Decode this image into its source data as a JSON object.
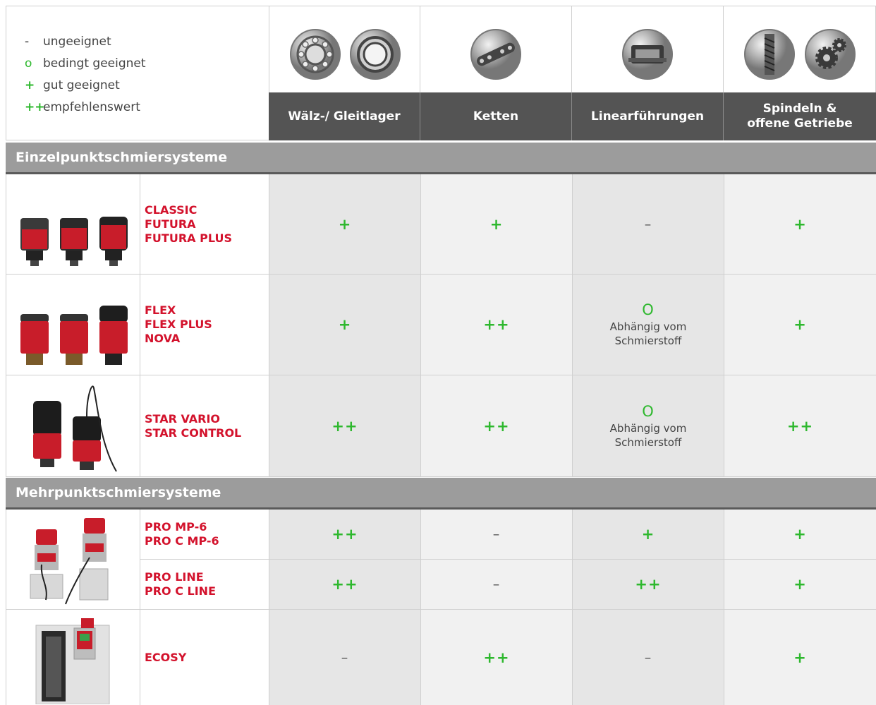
{
  "legend": [
    {
      "symbol": "-",
      "label": "ungeeignet",
      "kind": "plain"
    },
    {
      "symbol": "o",
      "label": "bedingt geeignet",
      "kind": "o"
    },
    {
      "symbol": "+",
      "label": "gut geeignet",
      "kind": "plus"
    },
    {
      "symbol": "++",
      "label": "empfehlenswert",
      "kind": "plus"
    }
  ],
  "categories": [
    {
      "label": "Wälz-/ Gleitlager",
      "icons": [
        "ball-bearing-icon",
        "plain-bearing-icon"
      ]
    },
    {
      "label": "Ketten",
      "icons": [
        "chain-icon"
      ]
    },
    {
      "label": "Linearführungen",
      "icons": [
        "linear-guide-icon"
      ]
    },
    {
      "label": "Spindeln &\noffene Getriebe",
      "icons": [
        "spindle-icon",
        "gears-icon"
      ]
    }
  ],
  "sections": [
    {
      "title": "Einzelpunktschmiersysteme",
      "rows": [
        {
          "names": [
            "CLASSIC",
            "FUTURA",
            "FUTURA PLUS"
          ],
          "values": [
            {
              "symbol": "+"
            },
            {
              "symbol": "+"
            },
            {
              "symbol": "–"
            },
            {
              "symbol": "+"
            }
          ]
        },
        {
          "names": [
            "FLEX",
            "FLEX PLUS",
            "NOVA"
          ],
          "values": [
            {
              "symbol": "+"
            },
            {
              "symbol": "++"
            },
            {
              "symbol": "O",
              "note1": "Abhängig vom",
              "note2": "Schmierstoff"
            },
            {
              "symbol": "+"
            }
          ]
        },
        {
          "names": [
            "STAR VARIO",
            "STAR CONTROL"
          ],
          "values": [
            {
              "symbol": "++"
            },
            {
              "symbol": "++"
            },
            {
              "symbol": "O",
              "note1": "Abhängig vom",
              "note2": "Schmierstoff"
            },
            {
              "symbol": "++"
            }
          ]
        }
      ]
    },
    {
      "title": "Mehrpunktschmiersysteme",
      "rows": [
        {
          "names": [
            "PRO MP-6",
            "PRO C  MP-6"
          ],
          "values": [
            {
              "symbol": "++"
            },
            {
              "symbol": "–"
            },
            {
              "symbol": "+"
            },
            {
              "symbol": "+"
            }
          ]
        },
        {
          "names": [
            "PRO LINE",
            "PRO C  LINE"
          ],
          "values": [
            {
              "symbol": "++"
            },
            {
              "symbol": "–"
            },
            {
              "symbol": "++"
            },
            {
              "symbol": "+"
            }
          ]
        },
        {
          "names": [
            "ECOSY"
          ],
          "values": [
            {
              "symbol": "–"
            },
            {
              "symbol": "++"
            },
            {
              "symbol": "–"
            },
            {
              "symbol": "+"
            }
          ]
        }
      ]
    }
  ],
  "colors": {
    "accent_red": "#d3122c",
    "plus_green": "#2eb82e",
    "header_dark": "#545454",
    "section_gray": "#9c9c9c"
  }
}
